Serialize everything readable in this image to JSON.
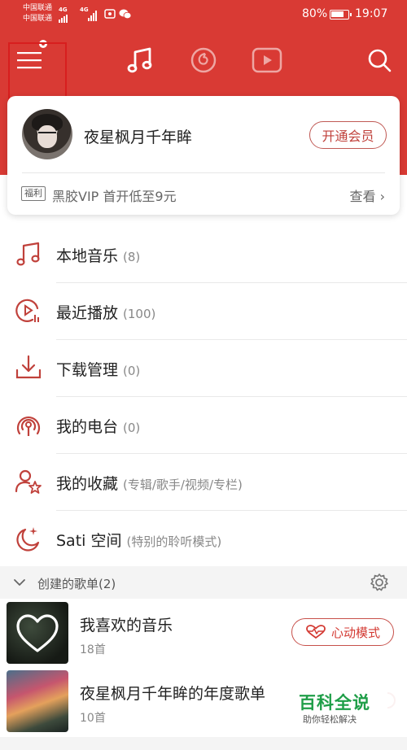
{
  "status_bar": {
    "carrier_1": "中国联通",
    "carrier_2": "中国联通",
    "net_1": "4G",
    "net_2": "4G",
    "battery_pct": "80%",
    "battery_level": 0.8,
    "time": "19:07"
  },
  "top_nav": {
    "icons": [
      "menu-icon",
      "music-note-icon",
      "netease-radio-icon",
      "video-play-icon",
      "search-icon"
    ],
    "highlight_color": "#d81e1e"
  },
  "profile": {
    "username": "夜星枫月千年眸",
    "vip_button": "开通会员",
    "promo_tag": "福利",
    "promo_text": "黑胶VIP 首开低至9元",
    "promo_link": "查看",
    "promo_chevron": "›"
  },
  "menu": [
    {
      "label": "本地音乐",
      "count": "(8)",
      "icon": "music-note-icon"
    },
    {
      "label": "最近播放",
      "count": "(100)",
      "icon": "recent-play-icon"
    },
    {
      "label": "下载管理",
      "count": "(0)",
      "icon": "download-icon"
    },
    {
      "label": "我的电台",
      "count": "(0)",
      "icon": "radio-icon"
    },
    {
      "label": "我的收藏",
      "count": "(专辑/歌手/视频/专栏)",
      "icon": "collect-icon"
    },
    {
      "label": "Sati 空间",
      "count": "(特别的聆听模式)",
      "icon": "moon-star-icon"
    }
  ],
  "section": {
    "title": "创建的歌单(2)"
  },
  "playlists": [
    {
      "title": "我喜欢的音乐",
      "subtitle": "18首",
      "action": "心动模式"
    },
    {
      "title": "夜星枫月千年眸的年度歌单",
      "subtitle": "10首"
    }
  ],
  "watermark": {
    "title": "百科全说",
    "subtitle": "助你轻松解决"
  },
  "colors": {
    "brand_red": "#d93a34",
    "text_primary": "#222222",
    "text_secondary": "#888888"
  }
}
